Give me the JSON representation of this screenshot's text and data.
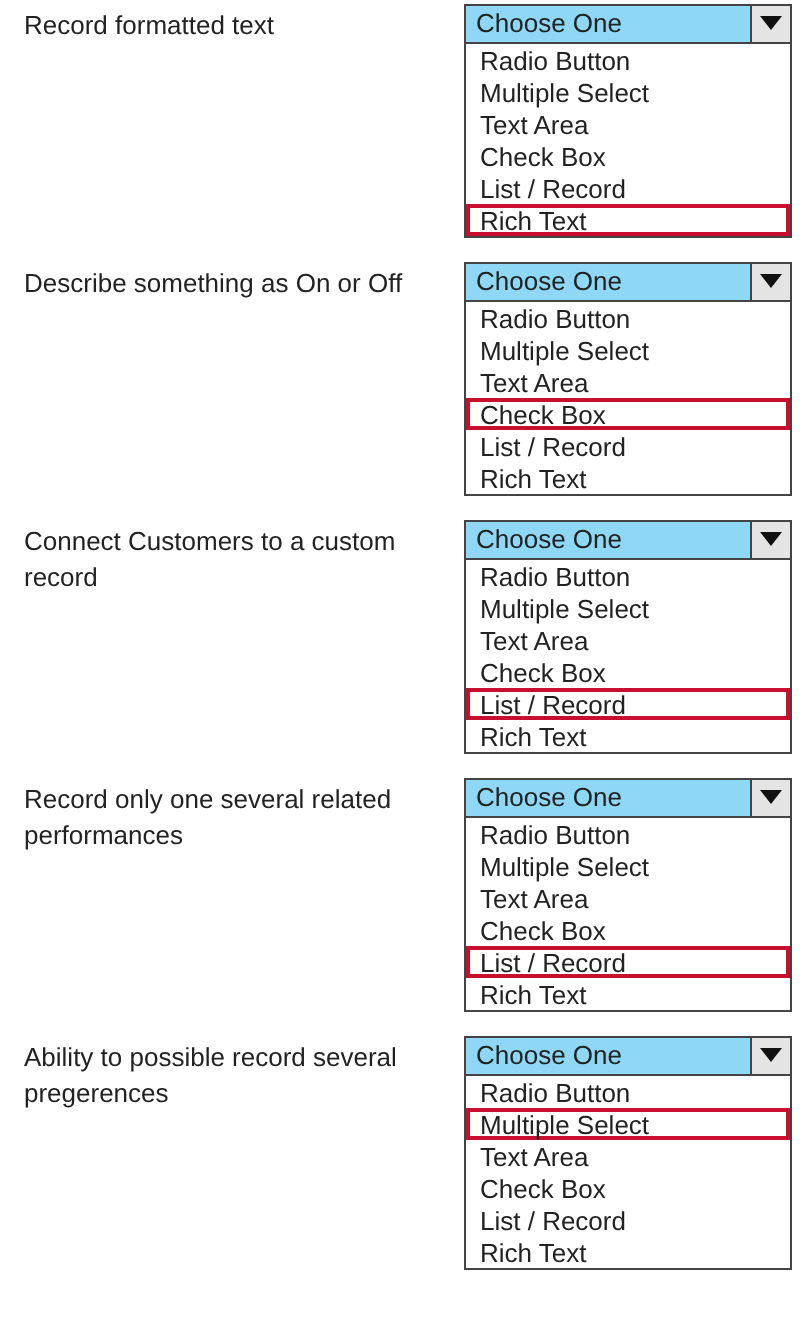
{
  "questions": [
    {
      "label": "Record formatted text",
      "dropdown": "Choose One",
      "options": [
        {
          "label": "Radio Button",
          "selected": false
        },
        {
          "label": "Multiple Select",
          "selected": false
        },
        {
          "label": "Text Area",
          "selected": false
        },
        {
          "label": "Check Box",
          "selected": false
        },
        {
          "label": "List / Record",
          "selected": false
        },
        {
          "label": "Rich Text",
          "selected": true
        }
      ]
    },
    {
      "label": "Describe something as On or Off",
      "dropdown": "Choose One",
      "options": [
        {
          "label": "Radio Button",
          "selected": false
        },
        {
          "label": "Multiple Select",
          "selected": false
        },
        {
          "label": "Text Area",
          "selected": false
        },
        {
          "label": "Check Box",
          "selected": true
        },
        {
          "label": "List / Record",
          "selected": false
        },
        {
          "label": "Rich Text",
          "selected": false
        }
      ]
    },
    {
      "label": "Connect Customers to a custom record",
      "dropdown": "Choose One",
      "options": [
        {
          "label": "Radio Button",
          "selected": false
        },
        {
          "label": "Multiple Select",
          "selected": false
        },
        {
          "label": "Text Area",
          "selected": false
        },
        {
          "label": "Check Box",
          "selected": false
        },
        {
          "label": "List / Record",
          "selected": true
        },
        {
          "label": "Rich Text",
          "selected": false
        }
      ]
    },
    {
      "label": "Record only one several related performances",
      "dropdown": "Choose One",
      "options": [
        {
          "label": "Radio Button",
          "selected": false
        },
        {
          "label": "Multiple Select",
          "selected": false
        },
        {
          "label": "Text Area",
          "selected": false
        },
        {
          "label": "Check Box",
          "selected": false
        },
        {
          "label": "List / Record",
          "selected": true
        },
        {
          "label": "Rich Text",
          "selected": false
        }
      ]
    },
    {
      "label": "Ability to possible record several pregerences",
      "dropdown": "Choose One",
      "options": [
        {
          "label": "Radio Button",
          "selected": false
        },
        {
          "label": "Multiple Select",
          "selected": true
        },
        {
          "label": "Text Area",
          "selected": false
        },
        {
          "label": "Check Box",
          "selected": false
        },
        {
          "label": "List / Record",
          "selected": false
        },
        {
          "label": "Rich Text",
          "selected": false
        }
      ]
    }
  ]
}
